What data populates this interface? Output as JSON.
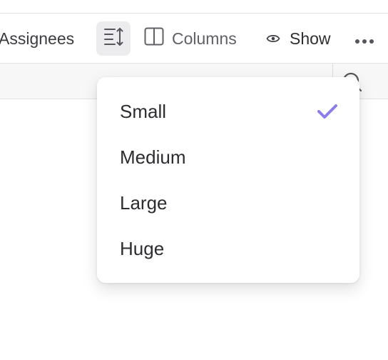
{
  "toolbar": {
    "assignees_label": "Assignees",
    "row_height_icon": "row-height-icon",
    "columns_label": "Columns",
    "columns_icon": "columns-icon",
    "show_label": "Show",
    "show_icon": "eye-icon",
    "more_icon": "more-horizontal-icon"
  },
  "subbar": {
    "search_icon": "search-icon"
  },
  "row_height_menu": {
    "selected": "Small",
    "options": [
      {
        "label": "Small",
        "selected": true
      },
      {
        "label": "Medium",
        "selected": false
      },
      {
        "label": "Large",
        "selected": false
      },
      {
        "label": "Huge",
        "selected": false
      }
    ]
  },
  "colors": {
    "accent_check": "#8b7ee8",
    "toolbar_active_bg": "#ececee"
  }
}
